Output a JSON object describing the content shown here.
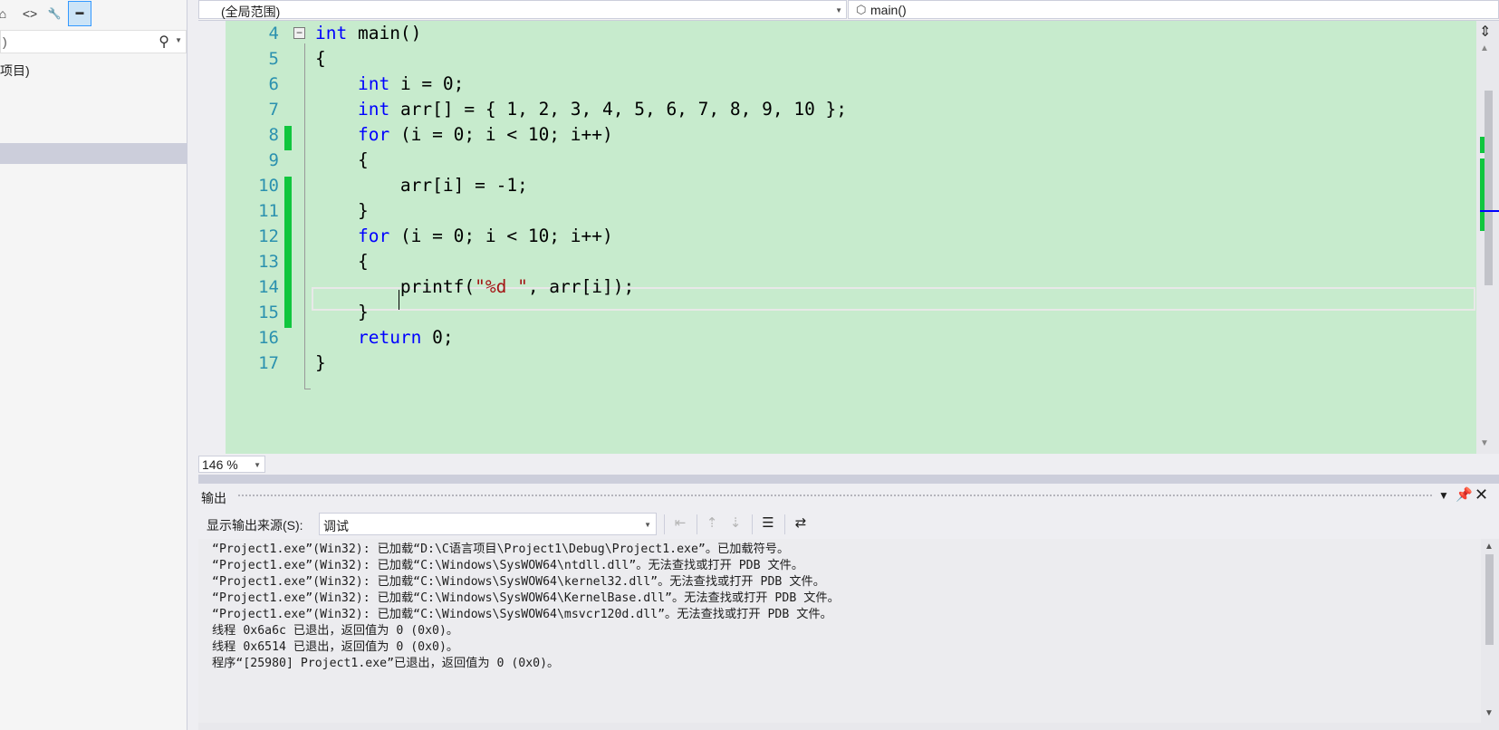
{
  "left_panel": {
    "toolbar": {
      "home_icon": "⌂",
      "code_icon": "<>",
      "wrench_icon": "🔧",
      "minus_icon": "▬"
    },
    "search_value": ")",
    "tree_item_label": "项目)"
  },
  "navbar": {
    "scope_label": "(全局范围)",
    "member_label": "main()"
  },
  "editor": {
    "line_numbers": [
      "4",
      "5",
      "6",
      "7",
      "8",
      "9",
      "10",
      "11",
      "12",
      "13",
      "14",
      "15",
      "16",
      "17"
    ],
    "zoom": "146 %"
  },
  "output": {
    "title": "输出",
    "source_label": "显示输出来源(S):",
    "source_value": "调试",
    "lines": [
      "“Project1.exe”(Win32): 已加载“D:\\C语言项目\\Project1\\Debug\\Project1.exe”。已加载符号。",
      "“Project1.exe”(Win32): 已加载“C:\\Windows\\SysWOW64\\ntdll.dll”。无法查找或打开 PDB 文件。",
      "“Project1.exe”(Win32): 已加载“C:\\Windows\\SysWOW64\\kernel32.dll”。无法查找或打开 PDB 文件。",
      "“Project1.exe”(Win32): 已加载“C:\\Windows\\SysWOW64\\KernelBase.dll”。无法查找或打开 PDB 文件。",
      "“Project1.exe”(Win32): 已加载“C:\\Windows\\SysWOW64\\msvcr120d.dll”。无法查找或打开 PDB 文件。",
      "线程 0x6a6c 已退出，返回值为 0 (0x0)。",
      "线程 0x6514 已退出，返回值为 0 (0x0)。",
      "程序“[25980] Project1.exe”已退出，返回值为 0 (0x0)。"
    ]
  },
  "colors": {
    "editor_bg": "#c7ebcd",
    "keyword": "#0000ff",
    "string": "#a31515",
    "line_number": "#2b91af",
    "change_marker": "#10c63e"
  }
}
